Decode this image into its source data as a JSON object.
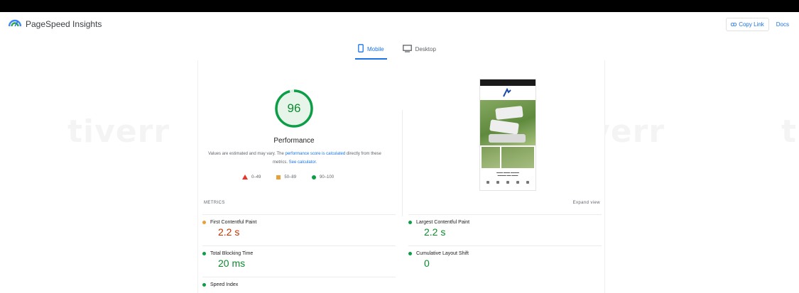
{
  "app": {
    "title": "PageSpeed Insights"
  },
  "header": {
    "copy_link_label": "Copy Link",
    "docs_label": "Docs"
  },
  "tabs": [
    {
      "label": "Mobile",
      "active": true
    },
    {
      "label": "Desktop",
      "active": false
    }
  ],
  "performance": {
    "score": "96",
    "title": "Performance",
    "desc_pre": "Values are estimated and may vary. The ",
    "desc_link": "performance score is calculated",
    "desc_mid": " directly from these metrics. ",
    "desc_calc": "See calculator."
  },
  "legend": [
    {
      "label": "0–49",
      "color": "#e8342c"
    },
    {
      "label": "50–89",
      "color": "#e8a03a"
    },
    {
      "label": "90–100",
      "color": "#0c9d47"
    }
  ],
  "metrics": {
    "section_label": "METRICS",
    "expand_label": "Expand view",
    "items": [
      {
        "name": "First Contentful Paint",
        "value": "2.2 s",
        "status": "average"
      },
      {
        "name": "Largest Contentful Paint",
        "value": "2.2 s",
        "status": "good"
      },
      {
        "name": "Total Blocking Time",
        "value": "20 ms",
        "status": "good"
      },
      {
        "name": "Cumulative Layout Shift",
        "value": "0",
        "status": "good"
      },
      {
        "name": "Speed Index",
        "value": "",
        "status": "good"
      }
    ]
  },
  "watermark": {
    "text": "tiverr"
  },
  "colors": {
    "accent": "#1a73e8",
    "good": "#0c9d47",
    "average": "#e8a03a",
    "poor": "#e8342c"
  }
}
